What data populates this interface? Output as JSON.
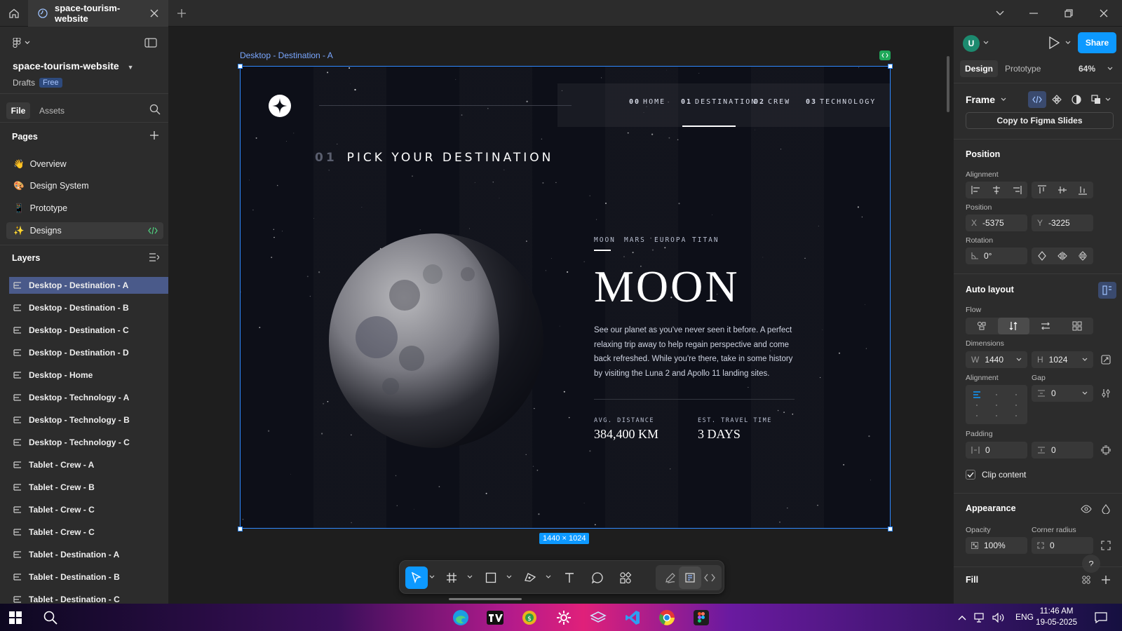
{
  "app": {
    "tab_title": "space-tourism-website",
    "project_name": "space-tourism-website",
    "drafts_label": "Drafts",
    "plan_badge": "Free"
  },
  "left_panel": {
    "tabs": {
      "file": "File",
      "assets": "Assets"
    },
    "pages_title": "Pages",
    "pages": [
      {
        "label": "Overview",
        "emoji": "👋"
      },
      {
        "label": "Design System",
        "emoji": "🎨"
      },
      {
        "label": "Prototype",
        "emoji": "📱"
      },
      {
        "label": "Designs",
        "emoji": "✨"
      }
    ],
    "layers_title": "Layers",
    "layers": [
      "Desktop - Destination - A",
      "Desktop - Destination - B",
      "Desktop - Destination - C",
      "Desktop - Destination - D",
      "Desktop - Home",
      "Desktop - Technology - A",
      "Desktop - Technology - B",
      "Desktop - Technology - C",
      "Tablet - Crew - A",
      "Tablet - Crew - B",
      "Tablet - Crew - C",
      "Tablet - Crew - C",
      "Tablet - Destination - A",
      "Tablet - Destination - B",
      "Tablet - Destination - C"
    ]
  },
  "canvas": {
    "frame_label": "Desktop - Destination - A",
    "size_badge": "1440 × 1024",
    "design": {
      "nav": [
        {
          "num": "00",
          "label": "HOME"
        },
        {
          "num": "01",
          "label": "DESTINATION"
        },
        {
          "num": "02",
          "label": "CREW"
        },
        {
          "num": "03",
          "label": "TECHNOLOGY"
        }
      ],
      "heading_num": "01",
      "heading": "PICK YOUR DESTINATION",
      "destinations": [
        "MOON",
        "MARS",
        "EUROPA",
        "TITAN"
      ],
      "title": "MOON",
      "description": "See our planet as you've never seen it before. A perfect relaxing trip away to help regain perspective and come back refreshed. While you're there, take in some history by visiting the Luna 2 and Apollo 11 landing sites.",
      "stats": [
        {
          "label": "AVG. DISTANCE",
          "value": "384,400 KM"
        },
        {
          "label": "EST. TRAVEL TIME",
          "value": "3 DAYS"
        }
      ]
    }
  },
  "right_panel": {
    "avatar_letter": "U",
    "share_label": "Share",
    "tabs": {
      "design": "Design",
      "prototype": "Prototype"
    },
    "zoom": "64%",
    "frame_label": "Frame",
    "copy_button": "Copy to Figma Slides",
    "position": {
      "title": "Position",
      "alignment_label": "Alignment",
      "position_label": "Position",
      "x_label": "X",
      "x_value": "-5375",
      "y_label": "Y",
      "y_value": "-3225",
      "rotation_label": "Rotation",
      "rotation_value": "0°"
    },
    "auto_layout": {
      "title": "Auto layout",
      "flow_label": "Flow",
      "dimensions_label": "Dimensions",
      "w_label": "W",
      "w_value": "1440",
      "h_label": "H",
      "h_value": "1024",
      "alignment_label": "Alignment",
      "gap_label": "Gap",
      "gap_value": "0",
      "padding_label": "Padding",
      "padding_h": "0",
      "padding_v": "0",
      "clip_content": "Clip content"
    },
    "appearance": {
      "title": "Appearance",
      "opacity_label": "Opacity",
      "opacity_value": "100%",
      "radius_label": "Corner radius",
      "radius_value": "0"
    },
    "fill_title": "Fill"
  },
  "taskbar": {
    "language": "ENG",
    "time": "11:46 AM",
    "date": "19-05-2025"
  },
  "colors": {
    "accent": "#0d99ff",
    "selection": "#2f89ff",
    "panel": "#2c2c2c",
    "canvas": "#1e1e1e"
  }
}
